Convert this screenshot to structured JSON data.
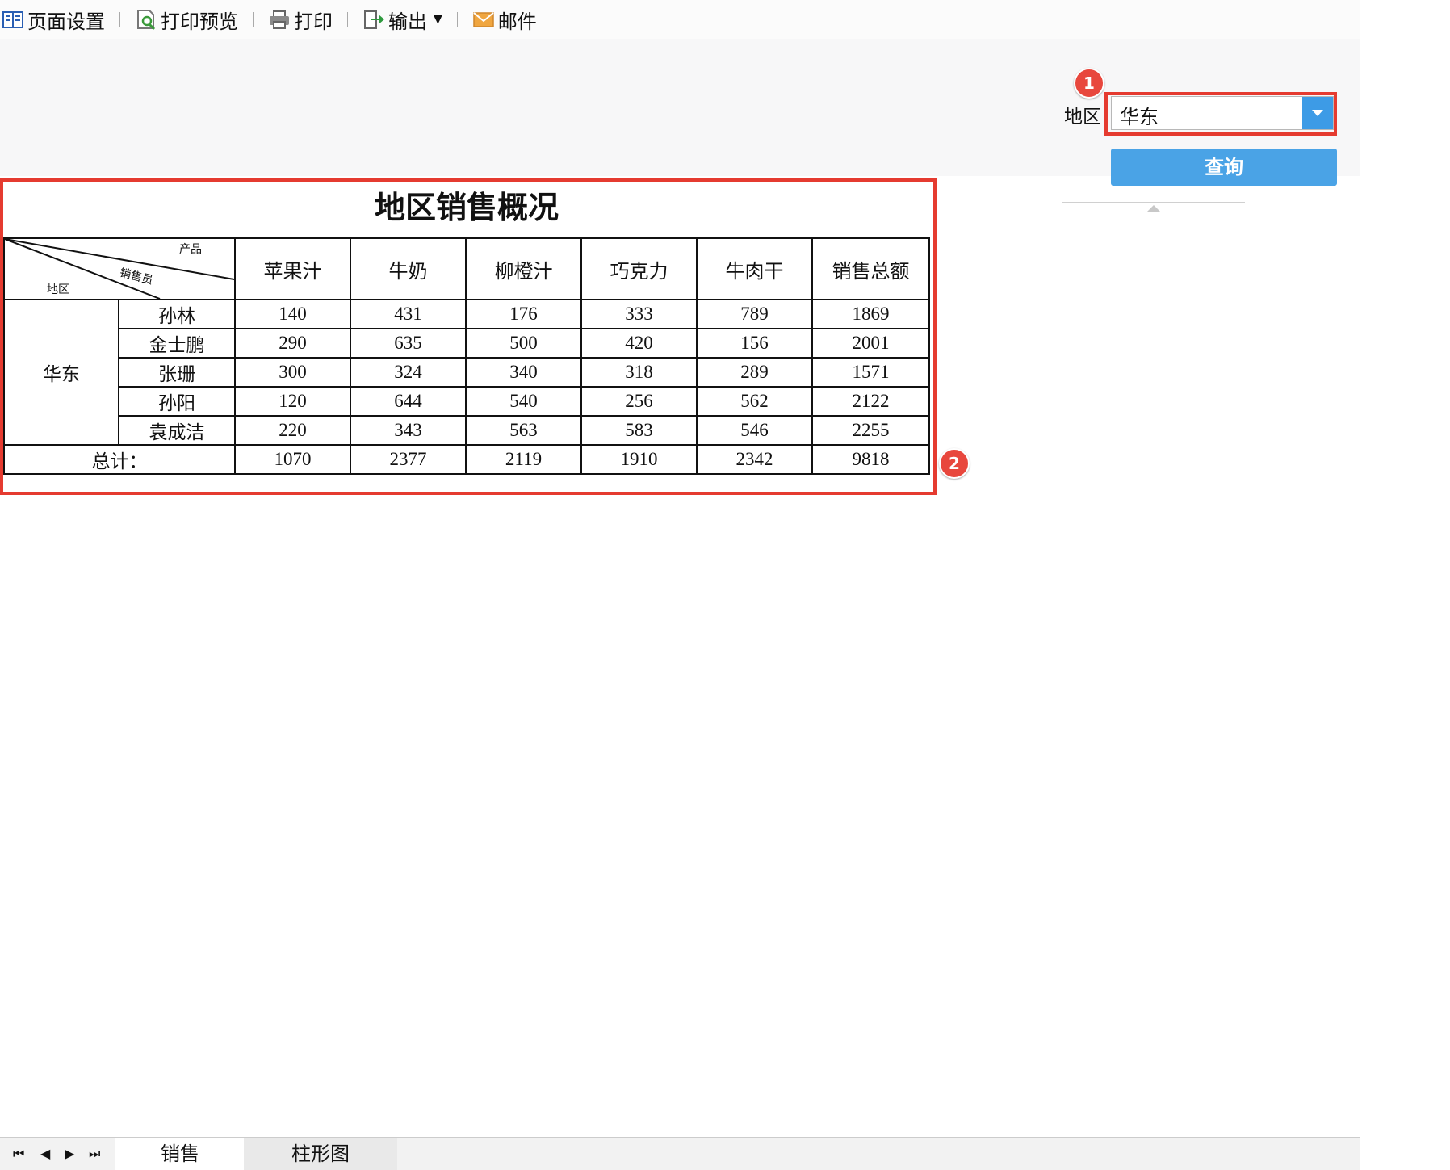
{
  "toolbar": {
    "items": [
      {
        "label": "页面设置",
        "icon": "page-setup-icon"
      },
      {
        "label": "打印预览",
        "icon": "print-preview-icon"
      },
      {
        "label": "打印",
        "icon": "printer-icon"
      },
      {
        "label": "输出",
        "icon": "export-icon"
      },
      {
        "label": "邮件",
        "icon": "mail-icon"
      }
    ]
  },
  "params": {
    "region_label": "地区",
    "region_value": "华东",
    "query_button": "查询"
  },
  "callouts": [
    "1",
    "2"
  ],
  "report": {
    "title": "地区销售概况",
    "corner": {
      "product": "产品",
      "salesperson": "销售员",
      "region": "地区"
    },
    "columns": [
      "苹果汁",
      "牛奶",
      "柳橙汁",
      "巧克力",
      "牛肉干",
      "销售总额"
    ],
    "region": "华东",
    "rows": [
      {
        "name": "孙林",
        "values": [
          "140",
          "431",
          "176",
          "333",
          "789",
          "1869"
        ]
      },
      {
        "name": "金士鹏",
        "values": [
          "290",
          "635",
          "500",
          "420",
          "156",
          "2001"
        ]
      },
      {
        "name": "张珊",
        "values": [
          "300",
          "324",
          "340",
          "318",
          "289",
          "1571"
        ]
      },
      {
        "name": "孙阳",
        "values": [
          "120",
          "644",
          "540",
          "256",
          "562",
          "2122"
        ]
      },
      {
        "name": "袁成洁",
        "values": [
          "220",
          "343",
          "563",
          "583",
          "546",
          "2255"
        ]
      }
    ],
    "total_label": "总计：",
    "totals": [
      "1070",
      "2377",
      "2119",
      "1910",
      "2342",
      "9818"
    ]
  },
  "sheets": {
    "active": "销售",
    "other": "柱形图"
  },
  "colors": {
    "accent": "#3d9be6",
    "callout": "#e53b30"
  }
}
